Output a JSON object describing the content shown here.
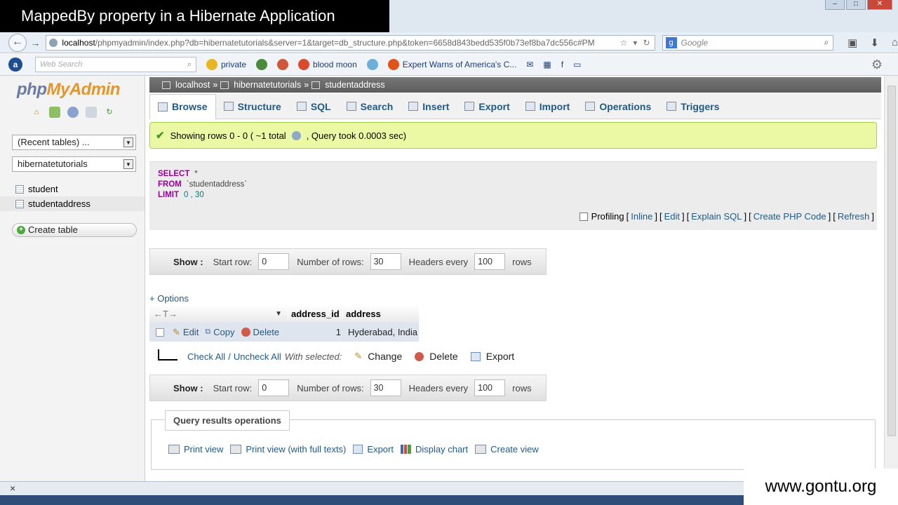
{
  "banner": {
    "title": "MappedBy property in a Hibernate Application"
  },
  "browser": {
    "url_host": "localhost",
    "url_path": "/phpmyadmin/index.php?db=hibernatetutorials&server=1&target=db_structure.php&token=6658d843bedd535f0b73ef8ba7dc556c#PM",
    "search_placeholder": "Google"
  },
  "toolbar": {
    "web_search_placeholder": "Web Search",
    "items": [
      "private",
      "blood moon",
      "Expert Warns of America's C..."
    ]
  },
  "sidebar": {
    "logo_php": "php",
    "logo_rest": "MyAdmin",
    "recent_tables": "(Recent tables) ...",
    "database": "hibernatetutorials",
    "tables": [
      "student",
      "studentaddress"
    ],
    "create_table": "Create table"
  },
  "breadcrumb": {
    "server": "localhost",
    "database": "hibernatetutorials",
    "table": "studentaddress",
    "sep": "»"
  },
  "tabs": [
    "Browse",
    "Structure",
    "SQL",
    "Search",
    "Insert",
    "Export",
    "Import",
    "Operations",
    "Triggers"
  ],
  "message": {
    "text": "Showing rows 0 - 0 ( ~1 total",
    "query_time": ", Query took 0.0003 sec)"
  },
  "sql": {
    "select_kw": "SELECT",
    "select_rest": "*",
    "from_kw": "FROM",
    "from_rest": "`studentaddress`",
    "limit_kw": "LIMIT",
    "limit_rest": "0 , 30",
    "profiling": "Profiling",
    "links": [
      "Inline",
      "Edit",
      "Explain SQL",
      "Create PHP Code",
      "Refresh"
    ]
  },
  "show_controls": {
    "show_label": "Show :",
    "start_row_label": "Start row:",
    "start_row": "0",
    "num_rows_label": "Number of rows:",
    "num_rows": "30",
    "headers_label": "Headers every",
    "headers_every": "100",
    "rows_label": "rows"
  },
  "options_link": "+ Options",
  "result": {
    "arrows": "←T→",
    "columns": [
      "address_id",
      "address"
    ],
    "row_actions": [
      "Edit",
      "Copy",
      "Delete"
    ],
    "rows": [
      {
        "address_id": "1",
        "address": "Hyderabad, India"
      }
    ]
  },
  "with_selected": {
    "check_all": "Check All",
    "separator": "/",
    "uncheck_all": "Uncheck All",
    "label": "With selected:",
    "actions": [
      "Change",
      "Delete",
      "Export"
    ]
  },
  "query_ops": {
    "title": "Query results operations",
    "links": [
      "Print view",
      "Print view (with full texts)",
      "Export",
      "Display chart",
      "Create view"
    ]
  },
  "statusbar": {
    "close": "×"
  },
  "watermark": "www.gontu.org"
}
